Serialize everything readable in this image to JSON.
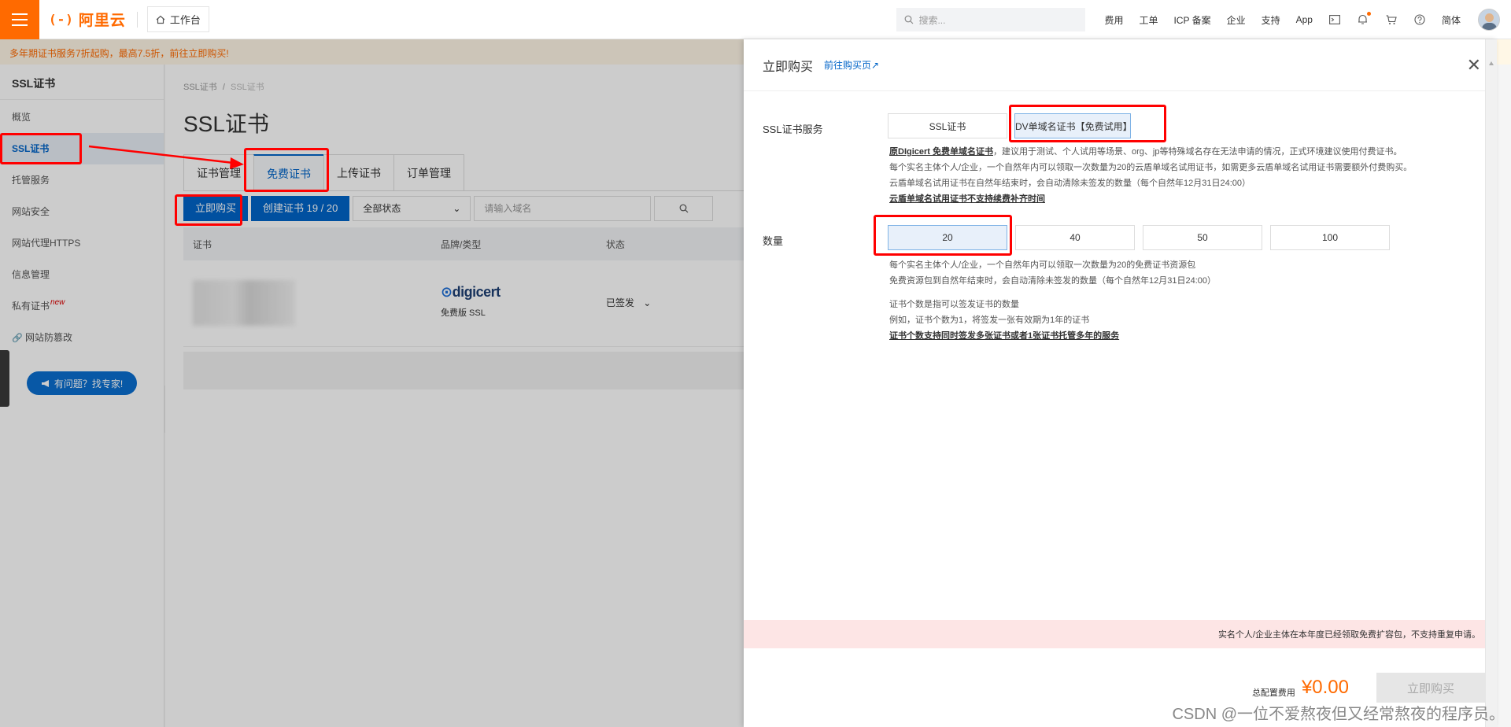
{
  "topbar": {
    "logo_mark": "(-)",
    "logo_text": "阿里云",
    "workbench": "工作台",
    "search_placeholder": "搜索...",
    "links": [
      "费用",
      "工单",
      "ICP 备案",
      "企业",
      "支持",
      "App"
    ],
    "lang": "简体"
  },
  "promo": "多年期证书服务7折起购，最高7.5折，前往立即购买!",
  "sidebar": {
    "title": "SSL证书",
    "items": [
      "概览",
      "SSL证书",
      "托管服务",
      "网站安全",
      "网站代理HTTPS",
      "信息管理",
      "私有证书",
      "网站防篡改"
    ],
    "new_badge": "new",
    "expert_button": "有问题？找专家!"
  },
  "main": {
    "breadcrumb_root": "SSL证书",
    "breadcrumb_sep": "/",
    "breadcrumb_current": "SSL证书",
    "title": "SSL证书",
    "tabs": [
      "证书管理",
      "免费证书",
      "上传证书",
      "订单管理"
    ],
    "buy_button": "立即购买",
    "create_button": "创建证书 19 / 20",
    "status_select": "全部状态",
    "domain_placeholder": "请输入域名",
    "columns": [
      "证书",
      "品牌/类型",
      "状态"
    ],
    "row": {
      "brand": "digicert",
      "type": "免费版 SSL",
      "status": "已签发"
    }
  },
  "drawer": {
    "title": "立即购买",
    "link": "前往购买页",
    "service_label": "SSL证书服务",
    "service_options": [
      "SSL证书",
      "DV单域名证书【免费试用】"
    ],
    "service_desc_lead": "原DIgicert 免费单域名证书",
    "service_desc_1": "，建议用于测试、个人试用等场景、org、jp等特殊域名存在无法申请的情况，正式环境建议使用付费证书。",
    "service_desc_2": "每个实名主体个人/企业，一个自然年内可以领取一次数量为20的云盾单域名试用证书，如需更多云盾单域名试用证书需要额外付费购买。",
    "service_desc_3": "云盾单域名试用证书在自然年结束时，会自动清除未签发的数量（每个自然年12月31日24:00）",
    "service_desc_link": "云盾单域名试用证书不支持续费补齐时间",
    "quantity_label": "数量",
    "quantity_options": [
      "20",
      "40",
      "50",
      "100"
    ],
    "qty_desc_1": "每个实名主体个人/企业，一个自然年内可以领取一次数量为20的免费证书资源包",
    "qty_desc_2": "免费资源包到自然年结束时，会自动清除未签发的数量（每个自然年12月31日24:00）",
    "qty_desc_3": "证书个数是指可以签发证书的数量",
    "qty_desc_4": "例如，证书个数为1，将签发一张有效期为1年的证书",
    "qty_desc_link": "证书个数支持同时签发多张证书或者1张证书托管多年的服务",
    "warning": "实名个人/企业主体在本年度已经领取免费扩容包，不支持重复申请。",
    "total_label": "总配置费用",
    "total_price": "¥0.00",
    "buy_button": "立即购买"
  },
  "watermark": "CSDN @一位不爱熬夜但又经常熬夜的程序员。",
  "colors": {
    "accent": "#ff6a00",
    "primary": "#0064c8",
    "highlight": "#ff0000"
  }
}
